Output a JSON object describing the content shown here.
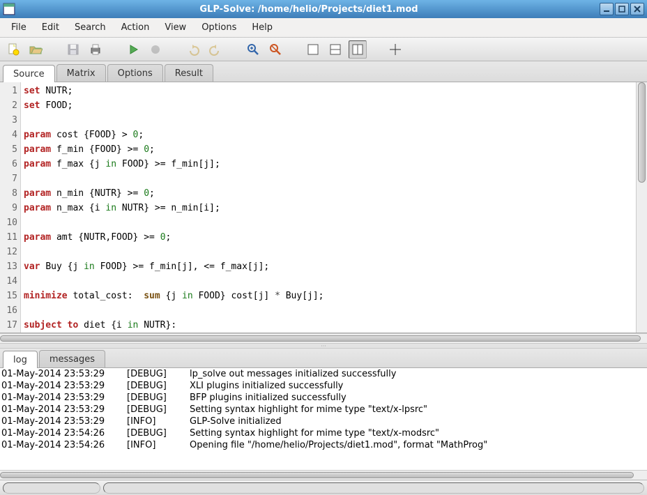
{
  "window": {
    "title": "GLP-Solve: /home/helio/Projects/diet1.mod"
  },
  "menu": {
    "file": "File",
    "edit": "Edit",
    "search": "Search",
    "action": "Action",
    "view": "View",
    "options": "Options",
    "help": "Help"
  },
  "tabs": {
    "source": "Source",
    "matrix": "Matrix",
    "options": "Options",
    "result": "Result",
    "active": "Source"
  },
  "source": {
    "lines": [
      [
        {
          "t": "set ",
          "c": "kw-set"
        },
        {
          "t": "NUTR;"
        }
      ],
      [
        {
          "t": "set ",
          "c": "kw-set"
        },
        {
          "t": "FOOD;"
        }
      ],
      [
        {
          "t": ""
        }
      ],
      [
        {
          "t": "param ",
          "c": "kw-param"
        },
        {
          "t": "cost {FOOD} > "
        },
        {
          "t": "0",
          "c": "num"
        },
        {
          "t": ";"
        }
      ],
      [
        {
          "t": "param ",
          "c": "kw-param"
        },
        {
          "t": "f_min {FOOD} >= "
        },
        {
          "t": "0",
          "c": "num"
        },
        {
          "t": ";"
        }
      ],
      [
        {
          "t": "param ",
          "c": "kw-param"
        },
        {
          "t": "f_max {j "
        },
        {
          "t": "in",
          "c": "kw-in"
        },
        {
          "t": " FOOD} >= f_min[j];"
        }
      ],
      [
        {
          "t": ""
        }
      ],
      [
        {
          "t": "param ",
          "c": "kw-param"
        },
        {
          "t": "n_min {NUTR} >= "
        },
        {
          "t": "0",
          "c": "num"
        },
        {
          "t": ";"
        }
      ],
      [
        {
          "t": "param ",
          "c": "kw-param"
        },
        {
          "t": "n_max {i "
        },
        {
          "t": "in",
          "c": "kw-in"
        },
        {
          "t": " NUTR} >= n_min[i];"
        }
      ],
      [
        {
          "t": ""
        }
      ],
      [
        {
          "t": "param ",
          "c": "kw-param"
        },
        {
          "t": "amt {NUTR,FOOD} >= "
        },
        {
          "t": "0",
          "c": "num"
        },
        {
          "t": ";"
        }
      ],
      [
        {
          "t": ""
        }
      ],
      [
        {
          "t": "var ",
          "c": "kw-var"
        },
        {
          "t": "Buy {j "
        },
        {
          "t": "in",
          "c": "kw-in"
        },
        {
          "t": " FOOD} >= f_min[j], <= f_max[j];"
        }
      ],
      [
        {
          "t": ""
        }
      ],
      [
        {
          "t": "minimize ",
          "c": "kw-minimize"
        },
        {
          "t": "total_cost:  "
        },
        {
          "t": "sum",
          "c": "kw-sum"
        },
        {
          "t": " {j "
        },
        {
          "t": "in",
          "c": "kw-in"
        },
        {
          "t": " FOOD} cost[j] "
        },
        {
          "t": "*",
          "c": "op"
        },
        {
          "t": " Buy[j];"
        }
      ],
      [
        {
          "t": ""
        }
      ],
      [
        {
          "t": "subject to ",
          "c": "kw-subjectto"
        },
        {
          "t": "diet {i "
        },
        {
          "t": "in",
          "c": "kw-in"
        },
        {
          "t": " NUTR}:"
        }
      ]
    ]
  },
  "bottomtabs": {
    "log": "log",
    "messages": "messages",
    "active": "log"
  },
  "log": {
    "rows": [
      {
        "ts": "01-May-2014  23:53:29",
        "lvl": "[DEBUG]",
        "msg": "lp_solve out messages initialized successfully"
      },
      {
        "ts": "01-May-2014  23:53:29",
        "lvl": "[DEBUG]",
        "msg": "XLI plugins initialized successfully"
      },
      {
        "ts": "01-May-2014  23:53:29",
        "lvl": "[DEBUG]",
        "msg": "BFP plugins initialized successfully"
      },
      {
        "ts": "01-May-2014  23:53:29",
        "lvl": "[DEBUG]",
        "msg": "Setting syntax highlight for mime type \"text/x-lpsrc\""
      },
      {
        "ts": "01-May-2014  23:53:29",
        "lvl": "[INFO]",
        "msg": "GLP-Solve initialized"
      },
      {
        "ts": "01-May-2014  23:54:26",
        "lvl": "[DEBUG]",
        "msg": "Setting syntax highlight for mime type \"text/x-modsrc\""
      },
      {
        "ts": "01-May-2014  23:54:26",
        "lvl": "[INFO]",
        "msg": "Opening file \"/home/helio/Projects/diet1.mod\", format \"MathProg\""
      }
    ]
  }
}
